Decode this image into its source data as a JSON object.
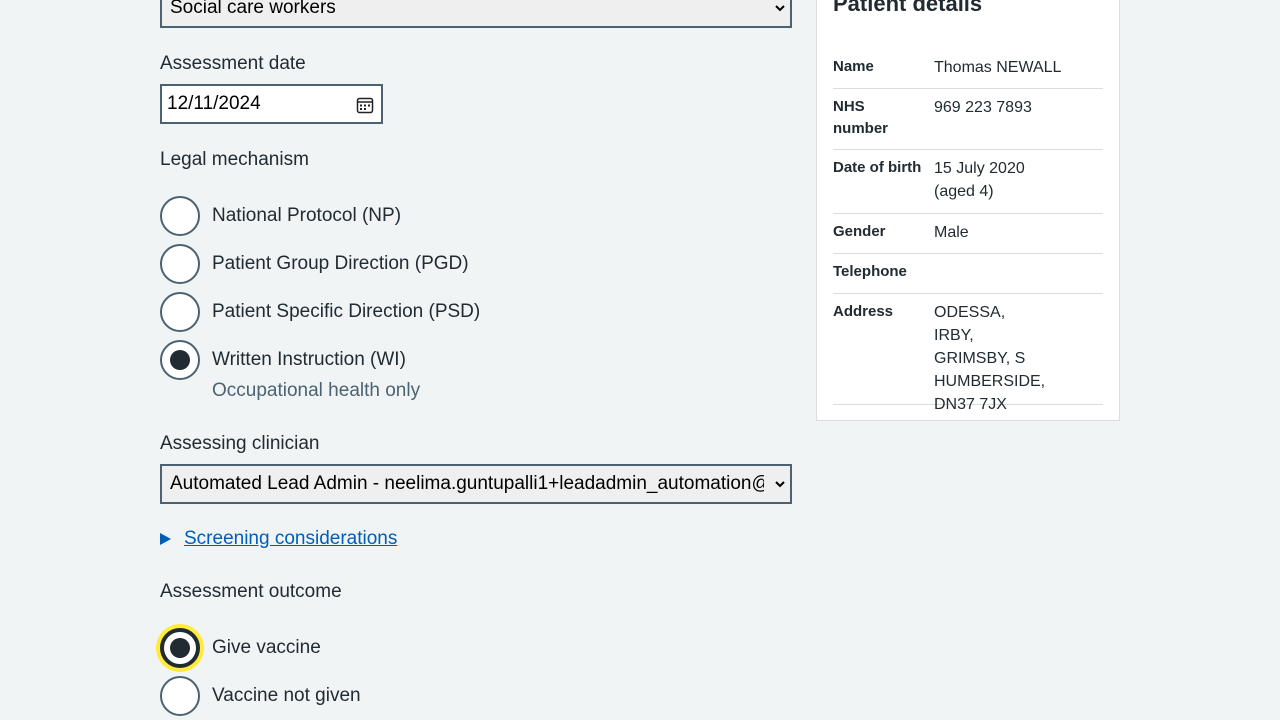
{
  "form": {
    "staff_group_select": {
      "value": "Social care workers"
    },
    "assessment_date": {
      "label": "Assessment date",
      "value": "12/11/2024"
    },
    "legal_mechanism": {
      "label": "Legal mechanism",
      "options": [
        {
          "label": "National Protocol (NP)",
          "checked": false
        },
        {
          "label": "Patient Group Direction (PGD)",
          "checked": false
        },
        {
          "label": "Patient Specific Direction (PSD)",
          "checked": false
        },
        {
          "label": "Written Instruction (WI)",
          "checked": true,
          "hint": "Occupational health only"
        }
      ]
    },
    "assessing_clinician": {
      "label": "Assessing clinician",
      "value": "Automated Lead Admin - neelima.guntupalli1+leadadmin_automation@nhs.net"
    },
    "screening_considerations": "Screening considerations",
    "assessment_outcome": {
      "label": "Assessment outcome",
      "options": [
        {
          "label": "Give vaccine",
          "checked": true
        },
        {
          "label": "Vaccine not given",
          "checked": false
        }
      ]
    }
  },
  "patient_details": {
    "title": "Patient details",
    "rows": [
      {
        "key": "Name",
        "value": "Thomas NEWALL"
      },
      {
        "key": "NHS number",
        "value": "969 223 7893"
      },
      {
        "key": "Date of birth",
        "value": "15 July 2020 (aged 4)"
      },
      {
        "key": "Gender",
        "value": "Male"
      },
      {
        "key": "Telephone",
        "value": ""
      },
      {
        "key": "Address",
        "value": "ODESSA, IRBY, GRIMSBY, S HUMBERSIDE, DN37 7JX"
      }
    ]
  },
  "colors": {
    "link": "#005eb8",
    "focus": "#ffeb3b",
    "text": "#212b32",
    "hint": "#4c6272"
  },
  "icons": {
    "calendar": "calendar-icon",
    "chevron": "chevron-down-icon",
    "disclosure": "triangle-right-icon"
  }
}
